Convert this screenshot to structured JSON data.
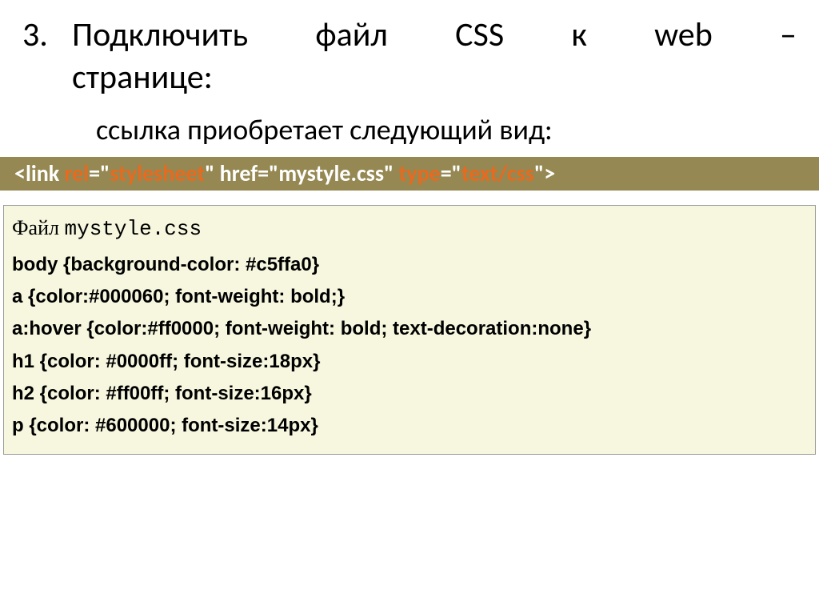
{
  "list_number": "3.",
  "heading_words": [
    "Подключить",
    "файл",
    "CSS",
    "к",
    "web",
    "–"
  ],
  "heading_line2": "странице:",
  "subheading": "ссылка приобретает следующий вид:",
  "link_tag": {
    "lt": "<",
    "tagname": "link ",
    "rel_attr": "rel",
    "eq1": "=\"",
    "rel_val": "stylesheet",
    "mid": "\" href=\"mystyle.css\" ",
    "type_attr": "type",
    "eq2": "=\"",
    "type_val": "text/css",
    "end": "\">"
  },
  "code": {
    "file_label": "Файл ",
    "file_name": "mystyle.css",
    "lines": [
      "body {background-color: #c5ffa0}",
      "a {color:#000060; font-weight: bold;}",
      "a:hover {color:#ff0000; font-weight: bold; text-decoration:none}",
      "h1 {color: #0000ff; font-size:18px}",
      "h2 {color: #ff00ff; font-size:16px}",
      "p {color: #600000; font-size:14px}"
    ]
  }
}
